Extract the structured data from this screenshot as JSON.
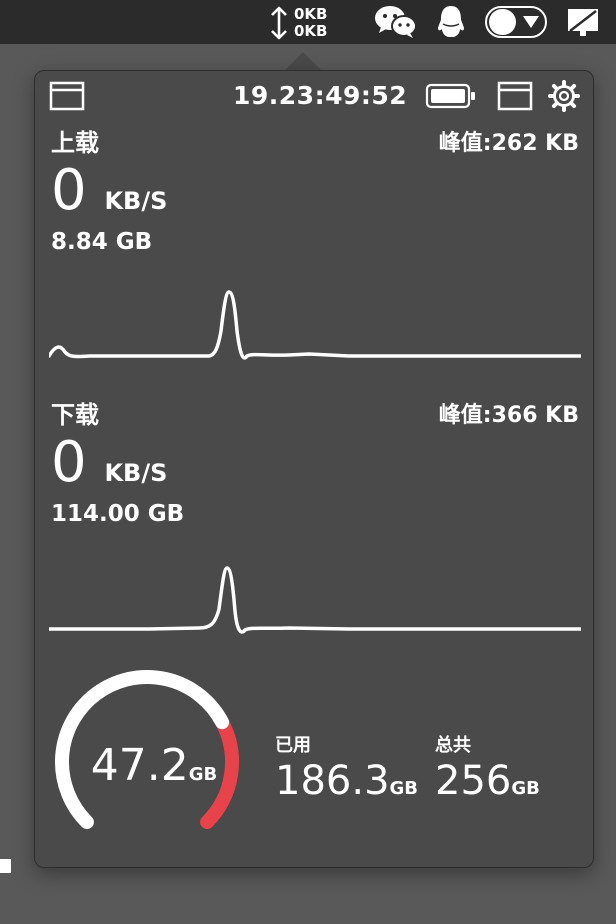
{
  "menubar": {
    "net_upload": "0KB",
    "net_download": "0KB",
    "icons": [
      "up-down-arrow-icon",
      "wechat-icon",
      "qq-icon",
      "toggle-menu-icon",
      "display-icon"
    ]
  },
  "panel": {
    "time": "19.23:49:52",
    "icons": [
      "window-icon",
      "battery-icon",
      "window-icon",
      "gear-icon"
    ],
    "upload": {
      "title": "上载",
      "peak": "峰值:262 KB",
      "rate": "0",
      "rate_unit": "KB/S",
      "total": "8.84 GB"
    },
    "download": {
      "title": "下载",
      "peak": "峰值:366 KB",
      "rate": "0",
      "rate_unit": "KB/S",
      "total": "114.00 GB"
    },
    "disk": {
      "free_value": "47.2",
      "free_unit": "GB",
      "used_label": "已用",
      "used_value": "186.3",
      "used_unit": "GB",
      "total_label": "总共",
      "total_value": "256",
      "total_unit": "GB",
      "used_fraction": 0.73,
      "colors": {
        "used": "#ffffff",
        "free": "#e8424a"
      }
    }
  }
}
